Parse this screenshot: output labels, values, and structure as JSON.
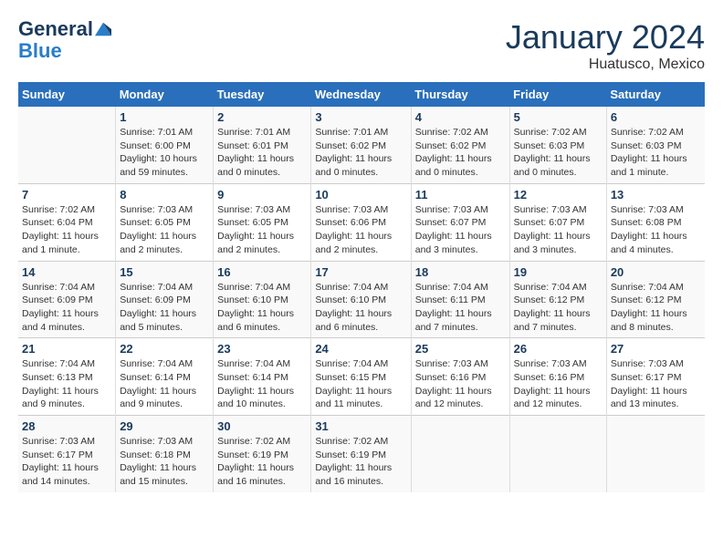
{
  "header": {
    "logo_line1": "General",
    "logo_line2": "Blue",
    "month": "January 2024",
    "location": "Huatusco, Mexico"
  },
  "days_of_week": [
    "Sunday",
    "Monday",
    "Tuesday",
    "Wednesday",
    "Thursday",
    "Friday",
    "Saturday"
  ],
  "weeks": [
    [
      {
        "num": "",
        "info": ""
      },
      {
        "num": "1",
        "info": "Sunrise: 7:01 AM\nSunset: 6:00 PM\nDaylight: 10 hours\nand 59 minutes."
      },
      {
        "num": "2",
        "info": "Sunrise: 7:01 AM\nSunset: 6:01 PM\nDaylight: 11 hours\nand 0 minutes."
      },
      {
        "num": "3",
        "info": "Sunrise: 7:01 AM\nSunset: 6:02 PM\nDaylight: 11 hours\nand 0 minutes."
      },
      {
        "num": "4",
        "info": "Sunrise: 7:02 AM\nSunset: 6:02 PM\nDaylight: 11 hours\nand 0 minutes."
      },
      {
        "num": "5",
        "info": "Sunrise: 7:02 AM\nSunset: 6:03 PM\nDaylight: 11 hours\nand 0 minutes."
      },
      {
        "num": "6",
        "info": "Sunrise: 7:02 AM\nSunset: 6:03 PM\nDaylight: 11 hours\nand 1 minute."
      }
    ],
    [
      {
        "num": "7",
        "info": "Sunrise: 7:02 AM\nSunset: 6:04 PM\nDaylight: 11 hours\nand 1 minute."
      },
      {
        "num": "8",
        "info": "Sunrise: 7:03 AM\nSunset: 6:05 PM\nDaylight: 11 hours\nand 2 minutes."
      },
      {
        "num": "9",
        "info": "Sunrise: 7:03 AM\nSunset: 6:05 PM\nDaylight: 11 hours\nand 2 minutes."
      },
      {
        "num": "10",
        "info": "Sunrise: 7:03 AM\nSunset: 6:06 PM\nDaylight: 11 hours\nand 2 minutes."
      },
      {
        "num": "11",
        "info": "Sunrise: 7:03 AM\nSunset: 6:07 PM\nDaylight: 11 hours\nand 3 minutes."
      },
      {
        "num": "12",
        "info": "Sunrise: 7:03 AM\nSunset: 6:07 PM\nDaylight: 11 hours\nand 3 minutes."
      },
      {
        "num": "13",
        "info": "Sunrise: 7:03 AM\nSunset: 6:08 PM\nDaylight: 11 hours\nand 4 minutes."
      }
    ],
    [
      {
        "num": "14",
        "info": "Sunrise: 7:04 AM\nSunset: 6:09 PM\nDaylight: 11 hours\nand 4 minutes."
      },
      {
        "num": "15",
        "info": "Sunrise: 7:04 AM\nSunset: 6:09 PM\nDaylight: 11 hours\nand 5 minutes."
      },
      {
        "num": "16",
        "info": "Sunrise: 7:04 AM\nSunset: 6:10 PM\nDaylight: 11 hours\nand 6 minutes."
      },
      {
        "num": "17",
        "info": "Sunrise: 7:04 AM\nSunset: 6:10 PM\nDaylight: 11 hours\nand 6 minutes."
      },
      {
        "num": "18",
        "info": "Sunrise: 7:04 AM\nSunset: 6:11 PM\nDaylight: 11 hours\nand 7 minutes."
      },
      {
        "num": "19",
        "info": "Sunrise: 7:04 AM\nSunset: 6:12 PM\nDaylight: 11 hours\nand 7 minutes."
      },
      {
        "num": "20",
        "info": "Sunrise: 7:04 AM\nSunset: 6:12 PM\nDaylight: 11 hours\nand 8 minutes."
      }
    ],
    [
      {
        "num": "21",
        "info": "Sunrise: 7:04 AM\nSunset: 6:13 PM\nDaylight: 11 hours\nand 9 minutes."
      },
      {
        "num": "22",
        "info": "Sunrise: 7:04 AM\nSunset: 6:14 PM\nDaylight: 11 hours\nand 9 minutes."
      },
      {
        "num": "23",
        "info": "Sunrise: 7:04 AM\nSunset: 6:14 PM\nDaylight: 11 hours\nand 10 minutes."
      },
      {
        "num": "24",
        "info": "Sunrise: 7:04 AM\nSunset: 6:15 PM\nDaylight: 11 hours\nand 11 minutes."
      },
      {
        "num": "25",
        "info": "Sunrise: 7:03 AM\nSunset: 6:16 PM\nDaylight: 11 hours\nand 12 minutes."
      },
      {
        "num": "26",
        "info": "Sunrise: 7:03 AM\nSunset: 6:16 PM\nDaylight: 11 hours\nand 12 minutes."
      },
      {
        "num": "27",
        "info": "Sunrise: 7:03 AM\nSunset: 6:17 PM\nDaylight: 11 hours\nand 13 minutes."
      }
    ],
    [
      {
        "num": "28",
        "info": "Sunrise: 7:03 AM\nSunset: 6:17 PM\nDaylight: 11 hours\nand 14 minutes."
      },
      {
        "num": "29",
        "info": "Sunrise: 7:03 AM\nSunset: 6:18 PM\nDaylight: 11 hours\nand 15 minutes."
      },
      {
        "num": "30",
        "info": "Sunrise: 7:02 AM\nSunset: 6:19 PM\nDaylight: 11 hours\nand 16 minutes."
      },
      {
        "num": "31",
        "info": "Sunrise: 7:02 AM\nSunset: 6:19 PM\nDaylight: 11 hours\nand 16 minutes."
      },
      {
        "num": "",
        "info": ""
      },
      {
        "num": "",
        "info": ""
      },
      {
        "num": "",
        "info": ""
      }
    ]
  ]
}
